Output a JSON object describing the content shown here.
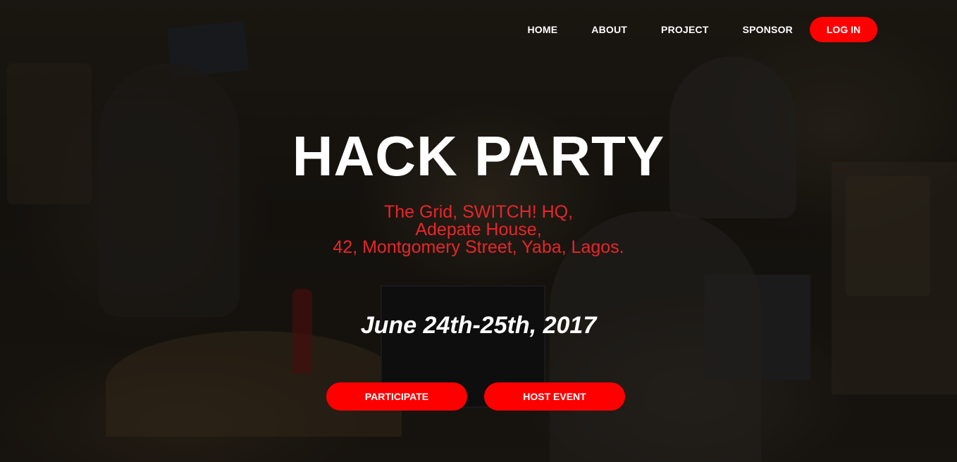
{
  "nav": {
    "items": [
      {
        "label": "HOME"
      },
      {
        "label": "ABOUT"
      },
      {
        "label": "PROJECT"
      },
      {
        "label": "SPONSOR"
      }
    ],
    "login_label": "LOG IN"
  },
  "hero": {
    "title": "HACK PARTY",
    "address_lines": [
      "The Grid, SWITCH! HQ,",
      "Adepate House,",
      "42, Montgomery Street, Yaba, Lagos."
    ],
    "date": "June 24th-25th, 2017",
    "participate_label": "PARTICIPATE",
    "host_label": "HOST EVENT"
  },
  "colors": {
    "accent": "#ff0000",
    "address_text": "#e8262a",
    "primary_text": "#ffffff"
  }
}
